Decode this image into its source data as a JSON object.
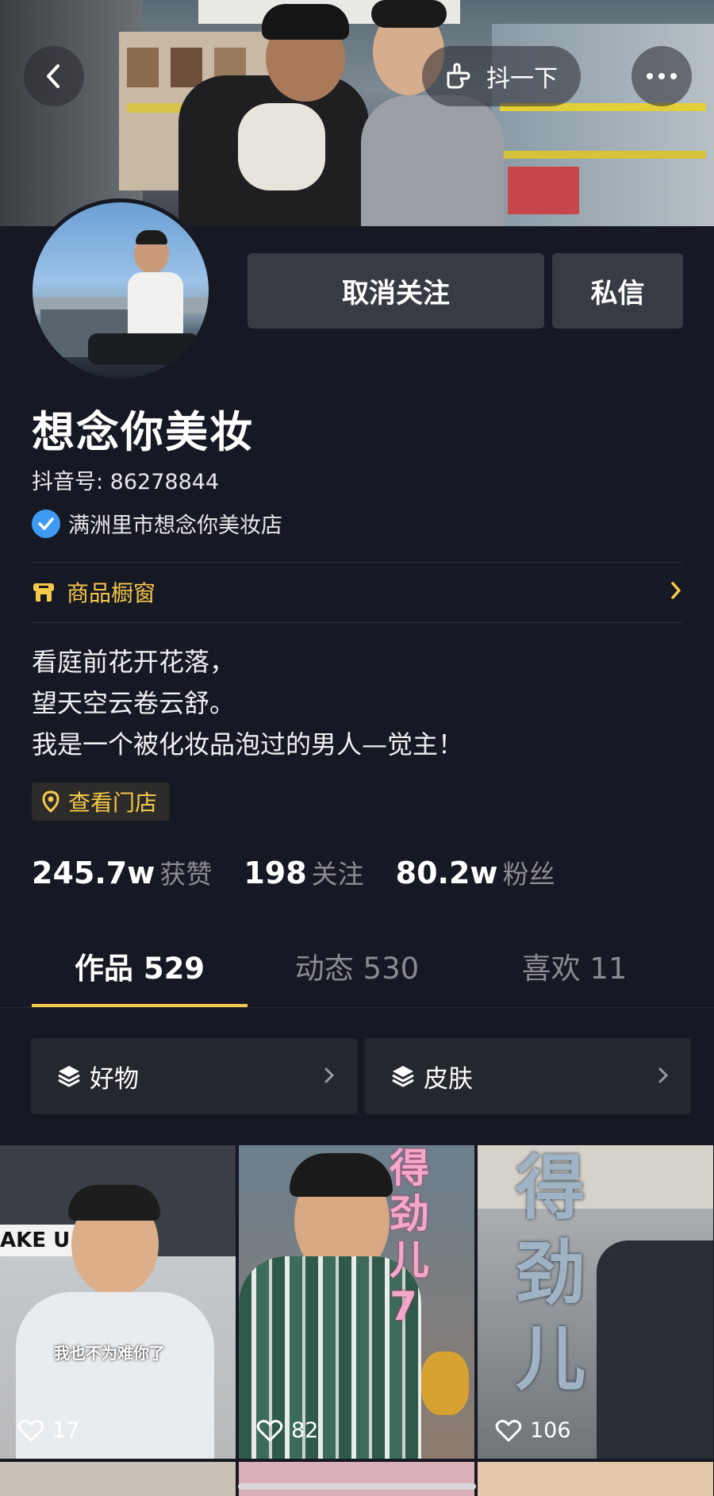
{
  "topbar": {
    "back_icon": "chevron-left-icon",
    "share_label": "抖一下",
    "more_icon": "more-dots-icon"
  },
  "profile": {
    "name": "想念你美妆",
    "douyin_id": "抖音号: 86278844",
    "verified_text": "满洲里市想念你美妆店",
    "unfollow_label": "取消关注",
    "message_label": "私信"
  },
  "shop": {
    "label": "商品橱窗",
    "icon": "shop-icon"
  },
  "bio": [
    "看庭前花开花落，",
    "望天空云卷云舒。",
    "我是一个被化妆品泡过的男人—觉主！"
  ],
  "store_chip": {
    "label": "查看门店",
    "icon": "location-pin-icon"
  },
  "stats": [
    {
      "value": "245.7w",
      "label": "获赞"
    },
    {
      "value": "198",
      "label": "关注"
    },
    {
      "value": "80.2w",
      "label": "粉丝"
    }
  ],
  "tabs": [
    {
      "label": "作品 529",
      "active": true
    },
    {
      "label": "动态 530",
      "active": false
    },
    {
      "label": "喜欢 11",
      "active": false
    }
  ],
  "collections": [
    {
      "label": "好物",
      "icon": "layers-icon"
    },
    {
      "label": "皮肤",
      "icon": "layers-icon"
    }
  ],
  "videos": [
    {
      "likes": "17",
      "overlay_text": "AKE U",
      "caption": "我也不为难你了"
    },
    {
      "likes": "82",
      "overlay_text": "得劲儿7"
    },
    {
      "likes": "106",
      "overlay_text": "得劲儿"
    }
  ],
  "colors": {
    "accent": "#f6c948",
    "background": "#161823",
    "button": "#393b44",
    "verified": "#3f9af5"
  }
}
